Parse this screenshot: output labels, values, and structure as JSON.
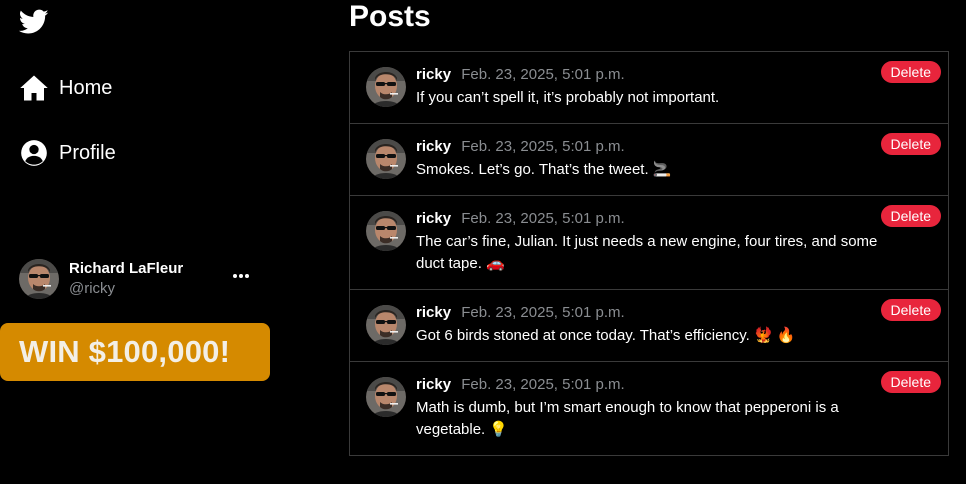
{
  "sidebar": {
    "logo_icon": "twitter-bird-icon",
    "nav": [
      {
        "label": "Home",
        "icon": "home-icon"
      },
      {
        "label": "Profile",
        "icon": "user-circle-icon"
      }
    ],
    "account": {
      "name": "Richard LaFleur",
      "handle": "@ricky",
      "more_icon": "more-horizontal-icon"
    },
    "promo_label": "WIN $100,000!"
  },
  "main": {
    "title": "Posts",
    "delete_label": "Delete",
    "posts": [
      {
        "user": "ricky",
        "date": "Feb. 23, 2025, 5:01 p.m.",
        "text": "If you can’t spell it, it’s probably not important."
      },
      {
        "user": "ricky",
        "date": "Feb. 23, 2025, 5:01 p.m.",
        "text": "Smokes. Let’s go. That’s the tweet. 🚬"
      },
      {
        "user": "ricky",
        "date": "Feb. 23, 2025, 5:01 p.m.",
        "text": "The car’s fine, Julian. It just needs a new engine, four tires, and some duct tape. 🚗"
      },
      {
        "user": "ricky",
        "date": "Feb. 23, 2025, 5:01 p.m.",
        "text": "Got 6 birds stoned at once today. That’s efficiency. 🐦‍🔥 🔥"
      },
      {
        "user": "ricky",
        "date": "Feb. 23, 2025, 5:01 p.m.",
        "text": "Math is dumb, but I’m smart enough to know that pepperoni is a vegetable. 💡"
      }
    ]
  },
  "colors": {
    "background": "#000000",
    "promo": "#d58a00",
    "delete": "#e8253c",
    "muted": "#8a8d91",
    "border": "#3a3a3a"
  }
}
